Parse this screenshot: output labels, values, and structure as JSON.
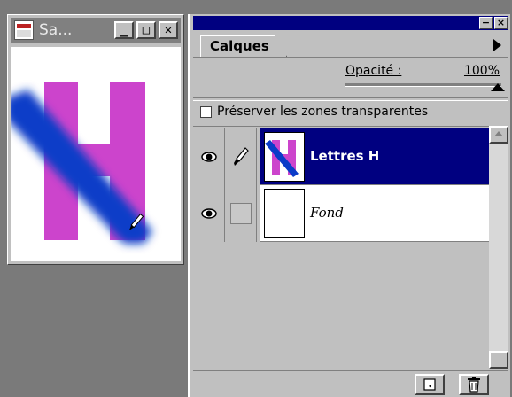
{
  "document_window": {
    "title": "Sa...",
    "buttons": {
      "minimize": "_",
      "maximize": "□",
      "close": "✕"
    },
    "canvas": {
      "letter": "H",
      "letter_color": "#cc44cc",
      "stroke_color": "#0a3cc8"
    }
  },
  "layers_panel": {
    "tab_label": "Calques",
    "opacity_label": "Opacité :",
    "opacity_value": "100%",
    "opacity_level": 1.0,
    "preserve_label": "Préserver les zones transparentes",
    "preserve_checked": false,
    "layers": [
      {
        "name": "Lettres H",
        "visible": true,
        "active": true,
        "brush": true
      },
      {
        "name": "Fond",
        "visible": true,
        "active": false,
        "brush": false
      }
    ],
    "bottom_buttons": [
      "new-layer-icon",
      "trash-icon"
    ]
  },
  "colors": {
    "titlebar_active": "#000080",
    "face": "#c0c0c0",
    "desktop": "#7a7a7a"
  }
}
